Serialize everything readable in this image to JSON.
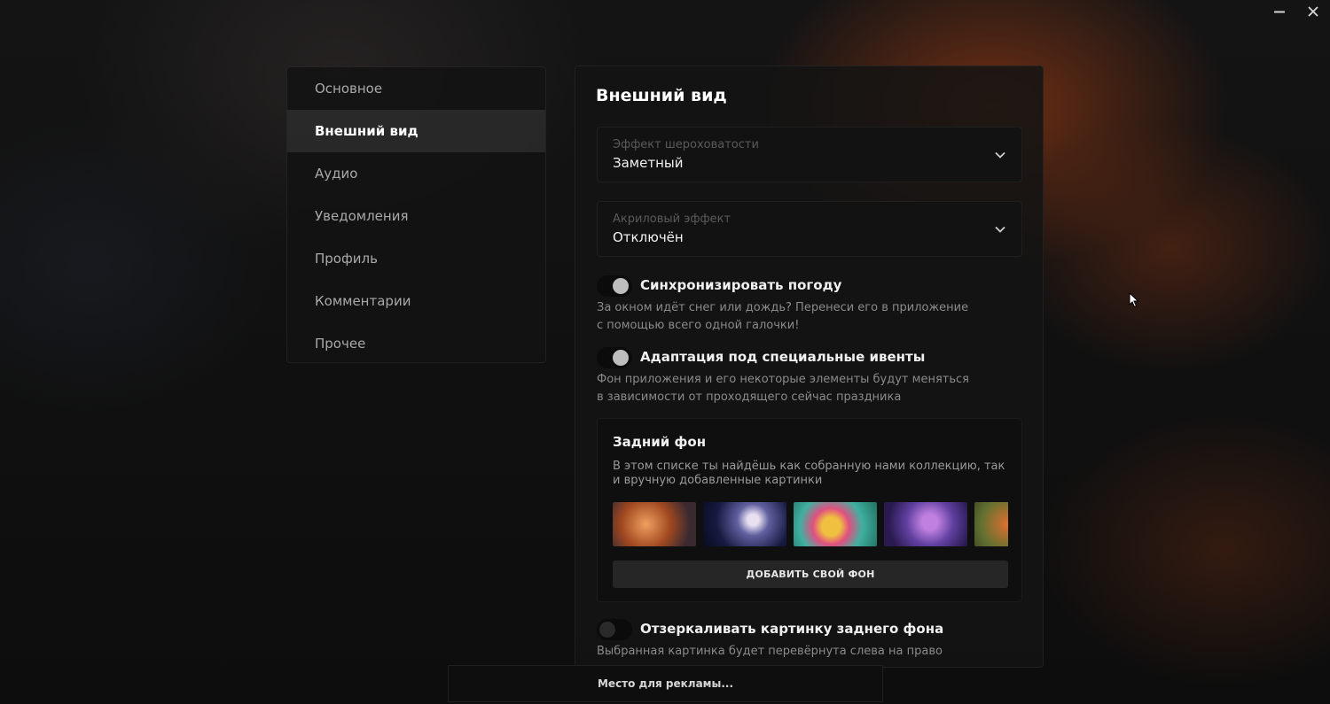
{
  "window": {
    "minimize_icon": "minimize-icon",
    "close_icon": "close-icon"
  },
  "sidebar": {
    "items": [
      {
        "label": "Основное"
      },
      {
        "label": "Внешний вид",
        "active": true
      },
      {
        "label": "Аудио"
      },
      {
        "label": "Уведомления"
      },
      {
        "label": "Профиль"
      },
      {
        "label": "Комментарии"
      },
      {
        "label": "Прочее"
      }
    ]
  },
  "main": {
    "title": "Внешний вид",
    "roughness": {
      "label": "Эффект шероховатости",
      "value": "Заметный",
      "icon": "chevron-down-icon"
    },
    "acrylic": {
      "label": "Акриловый эффект",
      "value": "Отключён",
      "icon": "chevron-down-icon"
    },
    "weather_sync": {
      "label": "Синхронизировать погоду",
      "description": "За окном идёт снег или дождь? Перенеси его в приложение с помощью всего одной галочки!",
      "enabled": true
    },
    "events": {
      "label": "Адаптация под специальные ивенты",
      "description_line1": "Фон приложения и его некоторые элементы будут меняться",
      "description_line2": "в зависимости от проходящего сейчас праздника",
      "enabled": true
    },
    "background": {
      "title": "Задний фон",
      "description": "В этом списке ты найдёшь как собранную нами коллекцию, так и вручную добавленные картинки",
      "add_button": "ДОБАВИТЬ СВОЙ ФОН"
    },
    "mirror": {
      "label": "Отзеркаливать картинку заднего фона",
      "description": "Выбранная картинка будет перевёрнута слева на право",
      "enabled": false
    }
  },
  "ad": {
    "text": "Место для рекламы..."
  }
}
